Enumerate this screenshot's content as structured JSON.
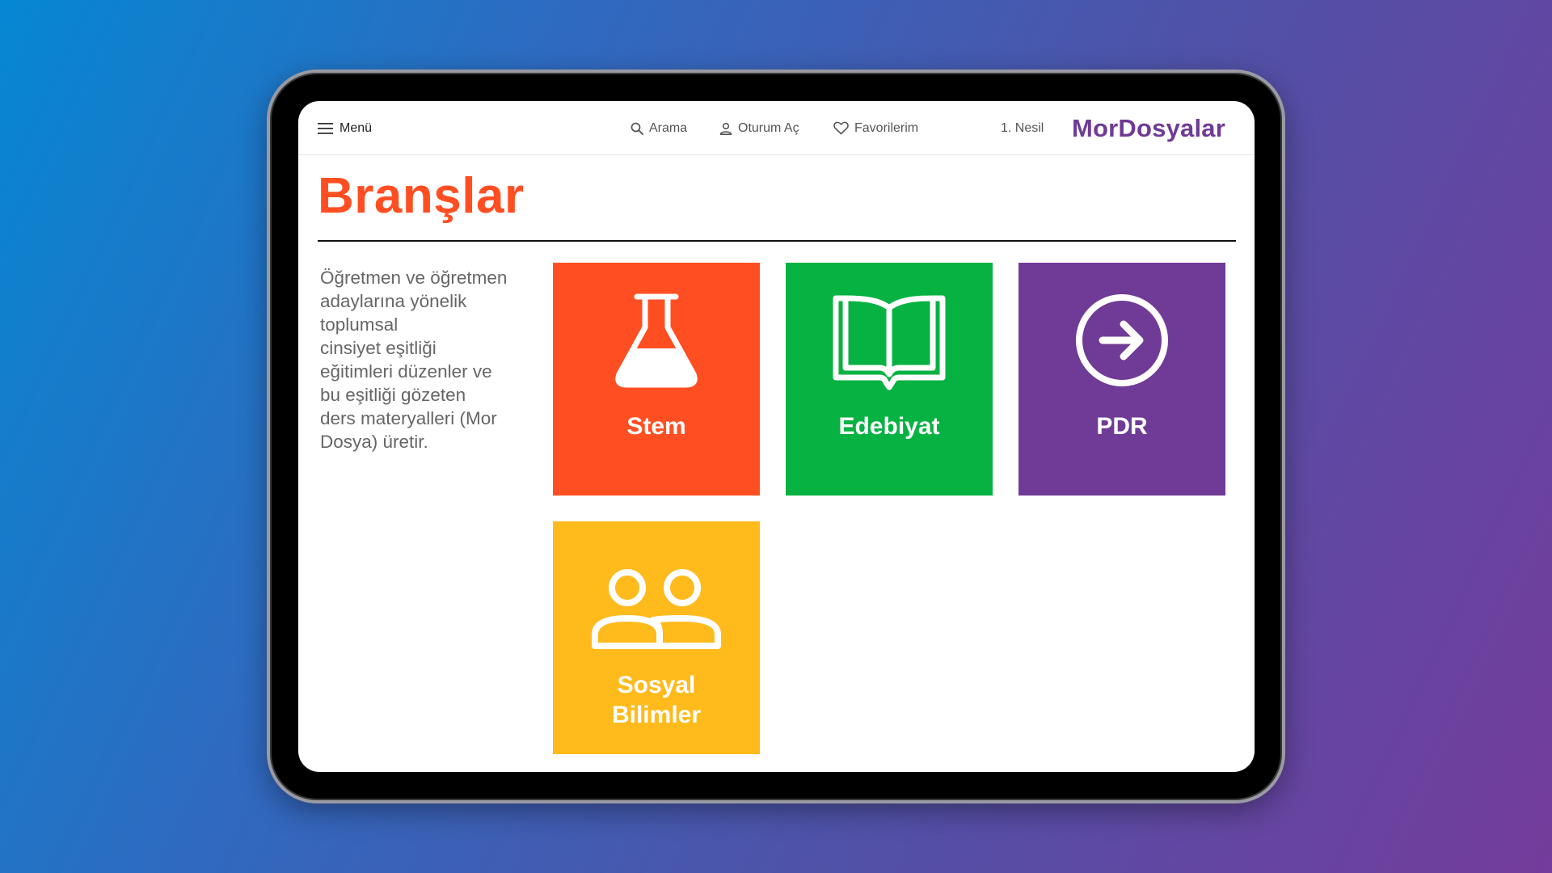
{
  "nav": {
    "menu_label": "Menü",
    "search_label": "Arama",
    "login_label": "Oturum Aç",
    "favorites_label": "Favorilerim",
    "generation_label": "1. Nesil",
    "brand": "MorDosyalar"
  },
  "page": {
    "title": "Branşlar",
    "description_lines": [
      "Öğretmen ve öğretmen",
      "adaylarına yönelik",
      "toplumsal",
      "cinsiyet eşitliği",
      "eğitimleri düzenler ve",
      "bu eşitliği gözeten",
      "ders materyalleri (Mor",
      "Dosya) üretir."
    ]
  },
  "tiles": [
    {
      "label": "Stem",
      "icon": "flask-icon",
      "color": "#ff4f22"
    },
    {
      "label": "Edebiyat",
      "icon": "open-book-icon",
      "color": "#06b241"
    },
    {
      "label": "PDR",
      "icon": "arrow-circle-right-icon",
      "color": "#703b96"
    },
    {
      "label_lines": [
        "Sosyal",
        "Bilimler"
      ],
      "icon": "people-icon",
      "color": "#ffba1c"
    }
  ],
  "colors": {
    "accent_title": "#ff4f22",
    "brand": "#6f3a96",
    "background_gradient": [
      "#0687d2",
      "#743c9c"
    ]
  }
}
